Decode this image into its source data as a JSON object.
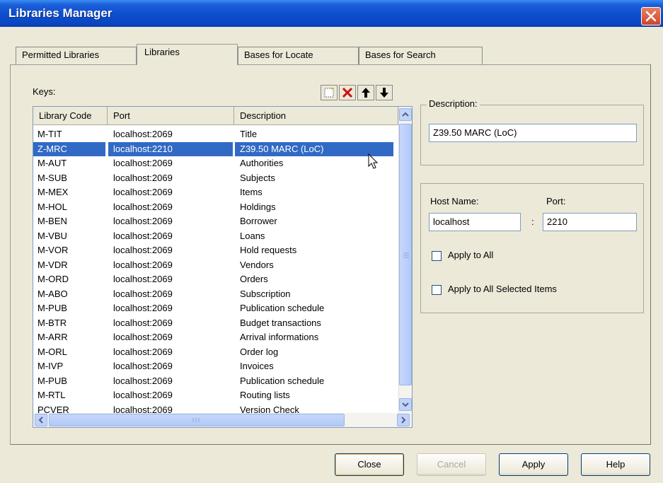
{
  "window": {
    "title": "Libraries Manager"
  },
  "tabs": [
    {
      "label": "Permitted Libraries"
    },
    {
      "label": "Libraries"
    },
    {
      "label": "Bases for Locate"
    },
    {
      "label": "Bases for Search"
    }
  ],
  "keys_label": "Keys:",
  "toolbar": [
    "new-icon",
    "delete-icon",
    "move-up-icon",
    "move-down-icon"
  ],
  "table": {
    "columns": [
      "Library Code",
      "Port",
      "Description"
    ],
    "rows": [
      {
        "code": "M-TIT",
        "port": "localhost:2069",
        "desc": "Title"
      },
      {
        "code": "Z-MRC",
        "port": "localhost:2210",
        "desc": "Z39.50 MARC (LoC)"
      },
      {
        "code": "M-AUT",
        "port": "localhost:2069",
        "desc": "Authorities"
      },
      {
        "code": "M-SUB",
        "port": "localhost:2069",
        "desc": "Subjects"
      },
      {
        "code": "M-MEX",
        "port": "localhost:2069",
        "desc": "Items"
      },
      {
        "code": "M-HOL",
        "port": "localhost:2069",
        "desc": "Holdings"
      },
      {
        "code": "M-BEN",
        "port": "localhost:2069",
        "desc": "Borrower"
      },
      {
        "code": "M-VBU",
        "port": "localhost:2069",
        "desc": "Loans"
      },
      {
        "code": "M-VOR",
        "port": "localhost:2069",
        "desc": "Hold requests"
      },
      {
        "code": "M-VDR",
        "port": "localhost:2069",
        "desc": "Vendors"
      },
      {
        "code": "M-ORD",
        "port": "localhost:2069",
        "desc": "Orders"
      },
      {
        "code": "M-ABO",
        "port": "localhost:2069",
        "desc": "Subscription"
      },
      {
        "code": "M-PUB",
        "port": "localhost:2069",
        "desc": "Publication schedule"
      },
      {
        "code": "M-BTR",
        "port": "localhost:2069",
        "desc": "Budget transactions"
      },
      {
        "code": "M-ARR",
        "port": "localhost:2069",
        "desc": "Arrival informations"
      },
      {
        "code": "M-ORL",
        "port": "localhost:2069",
        "desc": "Order log"
      },
      {
        "code": "M-IVP",
        "port": "localhost:2069",
        "desc": "Invoices"
      },
      {
        "code": "M-PUB",
        "port": "localhost:2069",
        "desc": "Publication schedule"
      },
      {
        "code": "M-RTL",
        "port": "localhost:2069",
        "desc": "Routing lists"
      },
      {
        "code": "PCVER",
        "port": "localhost:2069",
        "desc": "Version Check"
      }
    ]
  },
  "description": {
    "label": "Description:",
    "value": "Z39.50 MARC (LoC)"
  },
  "host": {
    "host_label": "Host Name:",
    "host_value": "localhost",
    "separator": ":",
    "port_label": "Port:",
    "port_value": "2210"
  },
  "options": {
    "apply_all": "Apply to All",
    "apply_selected": "Apply to All Selected Items"
  },
  "buttons": {
    "close": "Close",
    "cancel": "Cancel",
    "apply": "Apply",
    "help": "Help"
  }
}
